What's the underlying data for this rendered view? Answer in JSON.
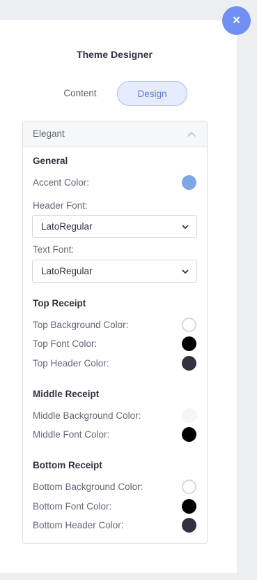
{
  "header": {
    "title": "Theme Designer",
    "close_glyph": "×"
  },
  "tabs": [
    {
      "label": "Content",
      "active": false
    },
    {
      "label": "Design",
      "active": true
    }
  ],
  "accordion": {
    "title": "Elegant",
    "expanded": true
  },
  "general": {
    "heading": "General",
    "accent_label": "Accent Color:",
    "accent_color": "#7ea7e5",
    "header_font_label": "Header Font:",
    "header_font_value": "LatoRegular",
    "text_font_label": "Text Font:",
    "text_font_value": "LatoRegular"
  },
  "top_receipt": {
    "heading": "Top Receipt",
    "rows": [
      {
        "label": "Top Background Color:",
        "color": "#ffffff"
      },
      {
        "label": "Top Font Color:",
        "color": "#000000"
      },
      {
        "label": "Top Header Color:",
        "color": "#30323f"
      }
    ]
  },
  "middle_receipt": {
    "heading": "Middle Receipt",
    "rows": [
      {
        "label": "Middle Background Color:",
        "color": "#f6f6f7"
      },
      {
        "label": "Middle Font Color:",
        "color": "#000000"
      }
    ]
  },
  "bottom_receipt": {
    "heading": "Bottom Receipt",
    "rows": [
      {
        "label": "Bottom Background Color:",
        "color": "#ffffff"
      },
      {
        "label": "Bottom Font Color:",
        "color": "#000000"
      },
      {
        "label": "Bottom Header Color:",
        "color": "#30323f"
      }
    ]
  },
  "colors": {
    "accent_blue": "#6f8ff2",
    "active_tab_bg": "#e6ecfc",
    "active_tab_text": "#5a79d6"
  }
}
